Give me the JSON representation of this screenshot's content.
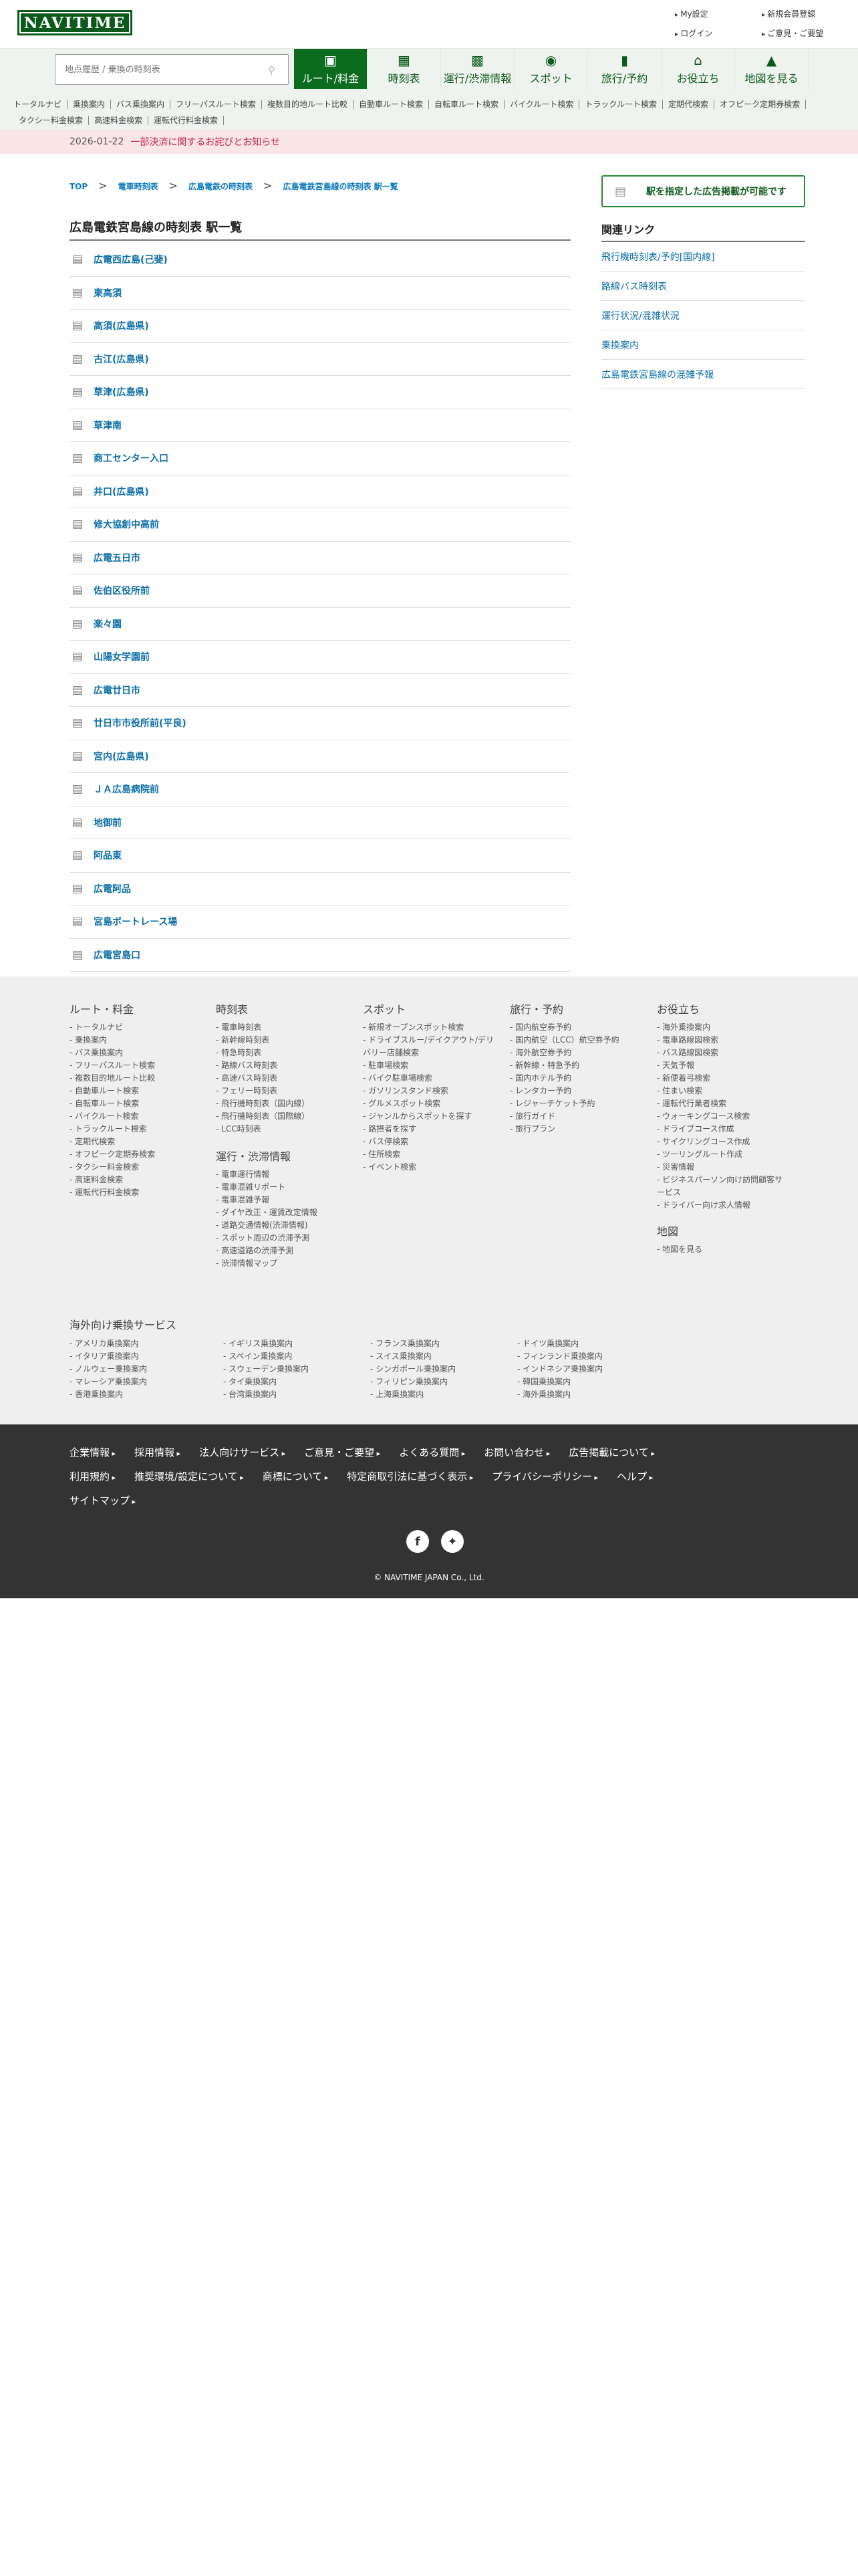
{
  "header": {
    "logo": "NAVITIME",
    "links": [
      "My設定",
      "新規会員登録",
      "ログイン",
      "ご意見・ご要望"
    ]
  },
  "nav": {
    "search_placeholder": "地点履歴 / 乗換の時刻表",
    "tabs": [
      {
        "label": "ルート/料金",
        "icon": "route-icon"
      },
      {
        "label": "時刻表",
        "icon": "timetable-icon"
      },
      {
        "label": "運行/渋滞情報",
        "icon": "traffic-icon"
      },
      {
        "label": "スポット",
        "icon": "spot-icon"
      },
      {
        "label": "旅行/予約",
        "icon": "travel-icon"
      },
      {
        "label": "お役立ち",
        "icon": "useful-icon"
      },
      {
        "label": "地図を見る",
        "icon": "map-icon"
      }
    ]
  },
  "subnav": [
    "トータルナビ",
    "乗換案内",
    "バス乗換案内",
    "フリーパスルート検索",
    "複数目的地ルート比較",
    "自動車ルート検索",
    "自転車ルート検索",
    "バイクルート検索",
    "トラックルート検索",
    "定期代検索",
    "オフピーク定期券検索",
    "タクシー料金検索",
    "高速料金検索",
    "運転代行料金検索"
  ],
  "notice": {
    "date": "2026-01-22",
    "text": "一部決済に関するお詫びとお知らせ"
  },
  "breadcrumb": [
    "TOP",
    "電車時刻表",
    "広島電鉄の時刻表",
    "広島電鉄宮島線の時刻表 駅一覧"
  ],
  "page_title": "広島電鉄宮島線の時刻表 駅一覧",
  "stations": [
    "広電西広島(己斐)",
    "東高須",
    "高須(広島県)",
    "古江(広島県)",
    "草津(広島県)",
    "草津南",
    "商工センター入口",
    "井口(広島県)",
    "修大協創中高前",
    "広電五日市",
    "佐伯区役所前",
    "楽々園",
    "山陽女学園前",
    "広電廿日市",
    "廿日市市役所前(平良)",
    "宮内(広島県)",
    "ＪＡ広島病院前",
    "地御前",
    "阿品東",
    "広電阿品",
    "宮島ボートレース場",
    "広電宮島口"
  ],
  "sidebar": {
    "ad_button": "駅を指定した広告掲載が可能です",
    "related_title": "関連リンク",
    "related": [
      "飛行機時刻表/予約[国内線]",
      "路線バス時刻表",
      "運行状況/混雑状況",
      "乗換案内",
      "広島電鉄宮島線の混雑予報"
    ]
  },
  "footer_sitemap": {
    "col1": {
      "title": "ルート・料金",
      "items": [
        "トータルナビ",
        "乗換案内",
        "バス乗換案内",
        "フリーパスルート検索",
        "複数目的地ルート比較",
        "自動車ルート検索",
        "自転車ルート検索",
        "バイクルート検索",
        "トラックルート検索",
        "定期代検索",
        "オフピーク定期券検索",
        "タクシー料金検索",
        "高速料金検索",
        "運転代行料金検索"
      ]
    },
    "col2": {
      "title": "時刻表",
      "items": [
        "電車時刻表",
        "新幹線時刻表",
        "特急時刻表",
        "路線バス時刻表",
        "高速バス時刻表",
        "フェリー時刻表",
        "飛行機時刻表（国内線）",
        "飛行機時刻表（国際線）",
        "LCC時刻表"
      ]
    },
    "col2b": {
      "title": "運行・渋滞情報",
      "items": [
        "電車運行情報",
        "電車混雑リポート",
        "電車混雑予報",
        "ダイヤ改正・運賃改定情報",
        "道路交通情報(渋滞情報)",
        "スポット周辺の渋滞予測",
        "高速道路の渋滞予測",
        "渋滞情報マップ"
      ]
    },
    "col3": {
      "title": "スポット",
      "items": [
        "新規オープンスポット検索",
        "ドライブスルー/デイクアウト/デリバリー店舗検索",
        "駐車場検索",
        "バイク駐車場検索",
        "ガソリンスタンド検索",
        "グルメスポット検索",
        "ジャンルからスポットを探す",
        "路摂者を探す",
        "バス停検索",
        "住所検索",
        "イベント検索"
      ]
    },
    "col4": {
      "title": "旅行・予約",
      "items": [
        "国内航空券予約",
        "国内航空（LCC）航空券予約",
        "海外航空券予約",
        "新幹線・特急予約",
        "国内ホテル予約",
        "レンタカー予約",
        "レジャーチケット予約",
        "旅行ガイド",
        "旅行プラン"
      ]
    },
    "col5": {
      "title": "お役立ち",
      "items": [
        "海外乗換案内",
        "電車路線図検索",
        "バス路線図検索",
        "天気予報",
        "新便着弓検索",
        "住まい検索",
        "運転代行業者検索",
        "ウォーキングコース検索",
        "ドライブコース作成",
        "サイクリングコース作成",
        "ツーリングルート作成",
        "災害情報",
        "ビジネスパーソン向け訪問顧客サービス",
        "ドライバー向け求人情報"
      ]
    },
    "col5b": {
      "title": "地図",
      "items": [
        "地図を見る"
      ]
    },
    "overseas": {
      "title": "海外向け乗換サービス",
      "items": [
        "アメリカ乗換案内",
        "イギリス乗換案内",
        "フランス乗換案内",
        "ドイツ乗換案内",
        "イタリア乗換案内",
        "スペイン乗換案内",
        "スイス乗換案内",
        "フィンランド乗換案内",
        "ノルウェー乗換案内",
        "スウェーデン乗換案内",
        "シンガポール乗換案内",
        "インドネシア乗換案内",
        "マレーシア乗換案内",
        "タイ乗換案内",
        "フィリピン乗換案内",
        "韓国乗換案内",
        "香港乗換案内",
        "台湾乗換案内",
        "上海乗換案内",
        "海外乗換案内"
      ]
    }
  },
  "footer_links": [
    "企業情報",
    "採用情報",
    "法人向けサービス",
    "ご意見・ご要望",
    "よくある質問",
    "お問い合わせ",
    "広告掲載について",
    "利用規約",
    "推奨環境/設定について",
    "商標について",
    "特定商取引法に基づく表示",
    "プライバシーポリシー",
    "ヘルプ",
    "サイトマップ"
  ],
  "copyright": "© NAVITIME JAPAN Co., Ltd."
}
